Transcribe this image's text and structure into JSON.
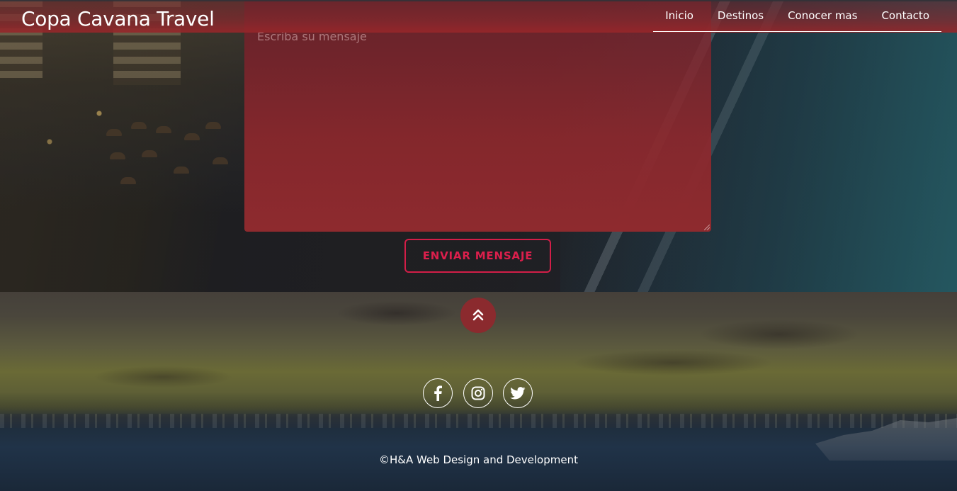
{
  "header": {
    "brand": "Copa Cavana Travel",
    "nav": [
      {
        "label": "Inicio"
      },
      {
        "label": "Destinos"
      },
      {
        "label": "Conocer mas"
      },
      {
        "label": "Contacto"
      }
    ]
  },
  "contact_form": {
    "message_placeholder": "Escriba su mensaje",
    "submit_label": "ENVIAR MENSAJE"
  },
  "footer": {
    "scroll_top_icon": "chevron-double-up-icon",
    "social": [
      {
        "name": "facebook",
        "icon": "facebook-icon"
      },
      {
        "name": "instagram",
        "icon": "instagram-icon"
      },
      {
        "name": "twitter",
        "icon": "twitter-icon"
      }
    ],
    "copyright": "©H&A Web Design and Development"
  },
  "colors": {
    "accent": "#d21e48",
    "header_red": "#96262a",
    "scroll_top_bg": "#8b2a2e",
    "textarea_red": "#8e2a2e"
  }
}
